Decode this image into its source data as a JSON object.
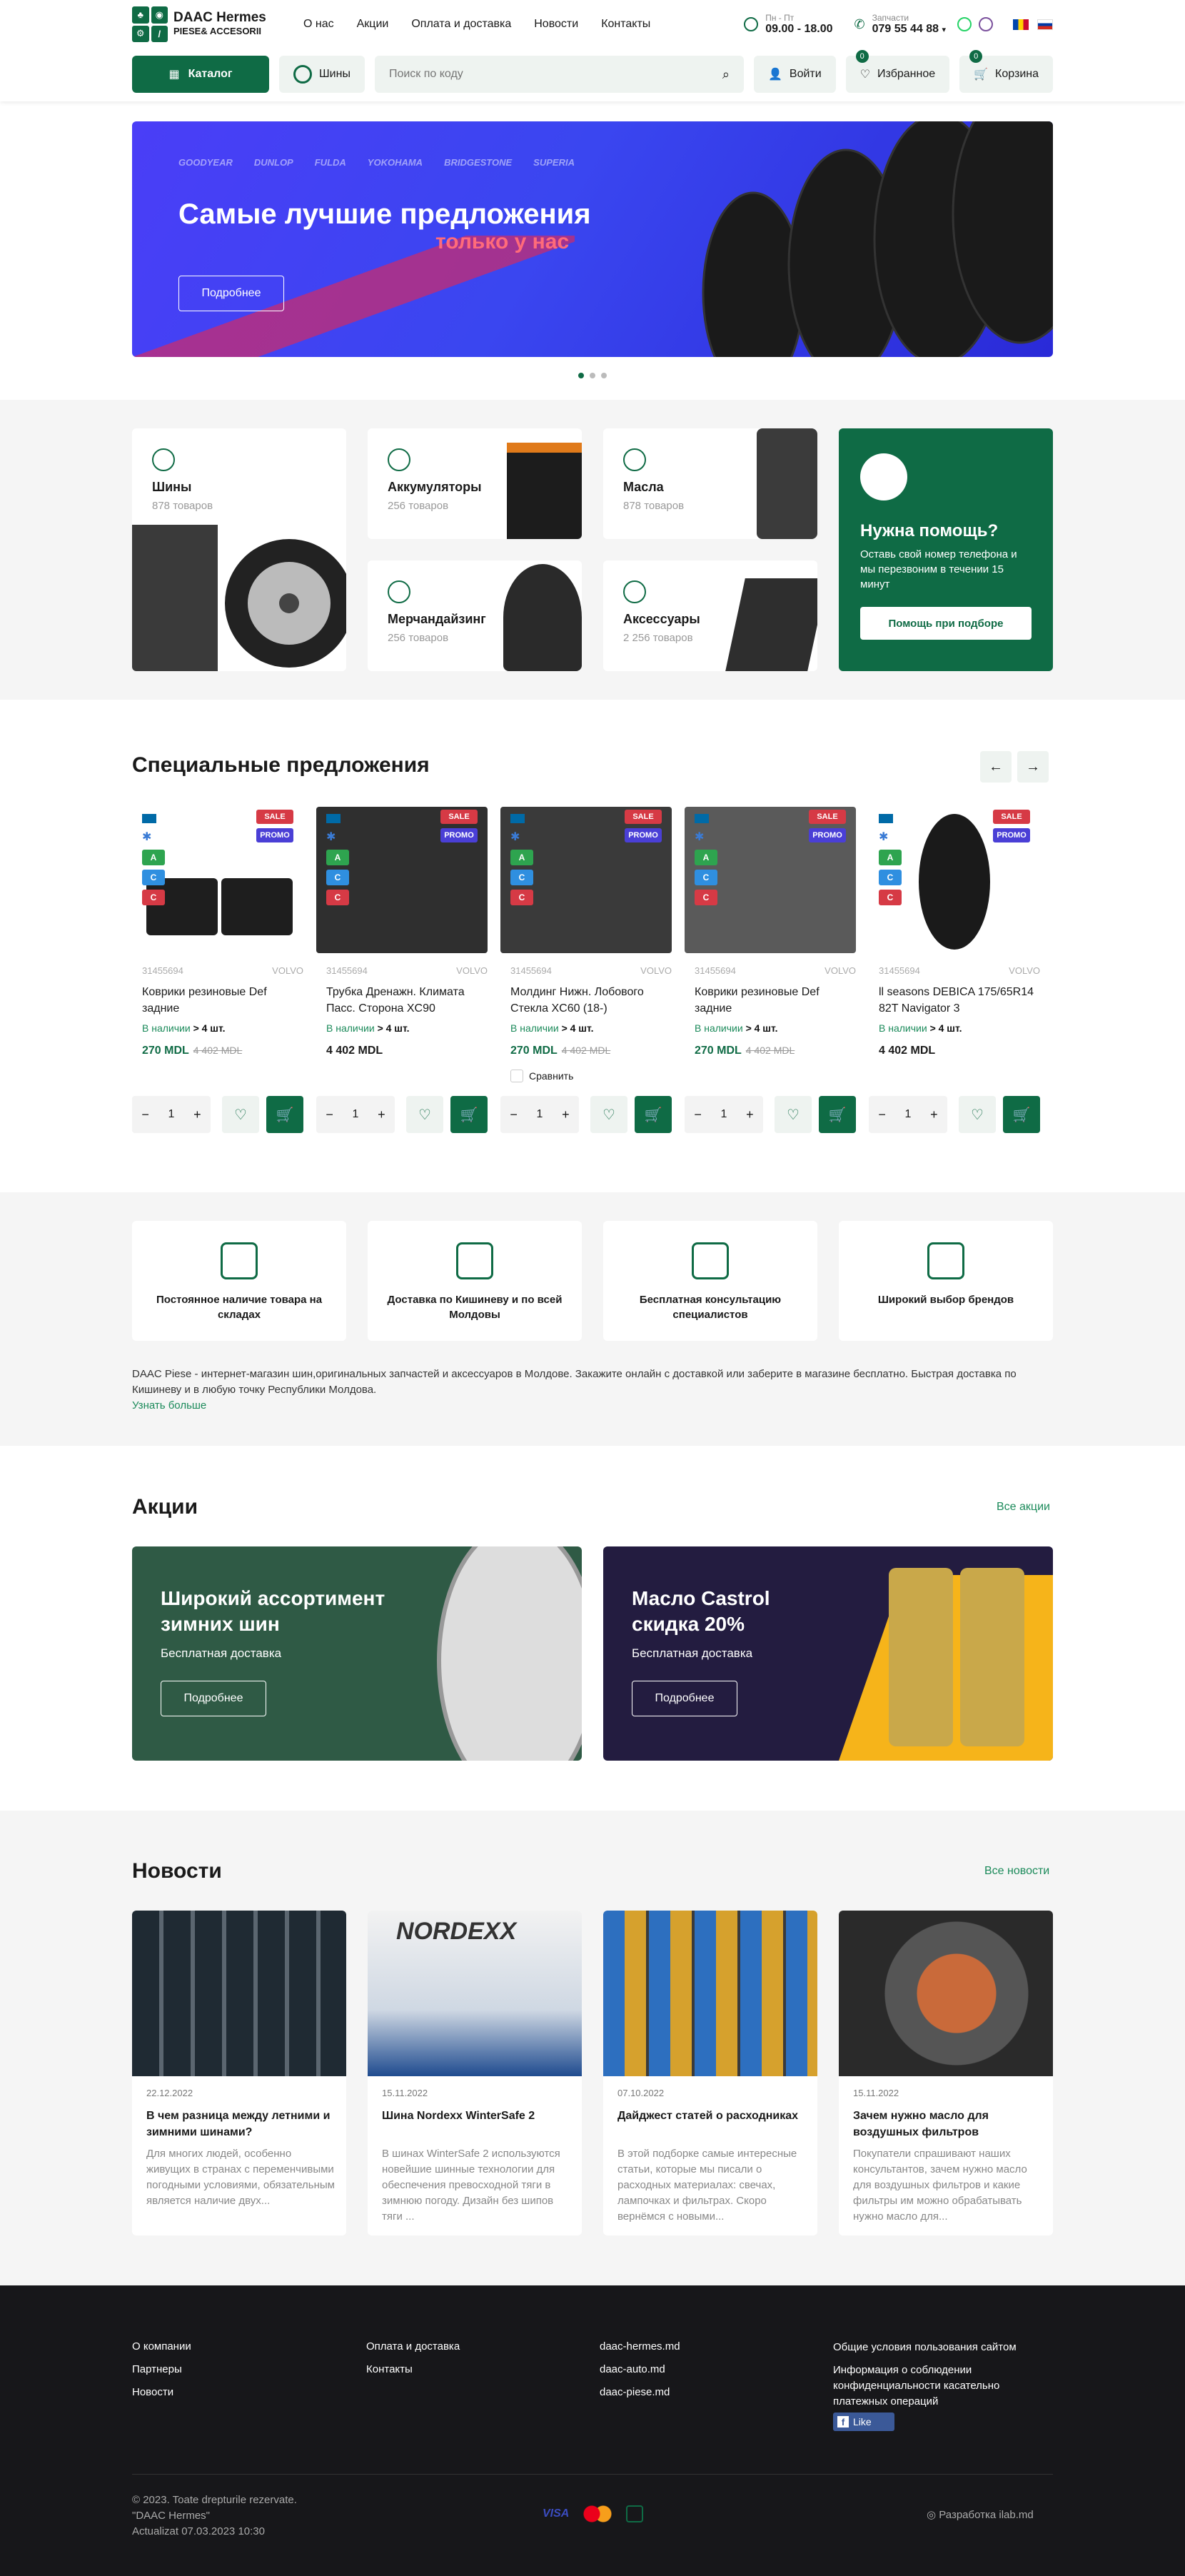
{
  "header": {
    "logo_title": "DAAC Hermes",
    "logo_subtitle": "PIESE& ACCESORII",
    "nav": [
      "О нас",
      "Акции",
      "Оплата и доставка",
      "Новости",
      "Контакты"
    ],
    "hours_label": "Пн - Пт",
    "hours_value": "09.00 - 18.00",
    "phone_label": "Запчасти",
    "phone_value": "079 55 44 88"
  },
  "toolbar": {
    "catalog_label": "Каталог",
    "tires_label": "Шины",
    "search_placeholder": "Поиск по коду",
    "login_label": "Войти",
    "favorites_label": "Избранное",
    "favorites_count": "0",
    "cart_label": "Корзина",
    "cart_count": "0"
  },
  "hero": {
    "brands": [
      "GOODYEAR",
      "DUNLOP",
      "FULDA",
      "YOKOHAMA",
      "BRIDGESTONE",
      "SUPERIA"
    ],
    "title": "Самые лучшие предложения",
    "subtitle": "только у нас",
    "button": "Подробнее"
  },
  "categories": [
    {
      "name": "Шины",
      "count": "878 товаров"
    },
    {
      "name": "Аккумуляторы",
      "count": "256 товаров"
    },
    {
      "name": "Масла",
      "count": "878 товаров"
    },
    {
      "name": "Мерчандайзинг",
      "count": "256 товаров"
    },
    {
      "name": "Аксессуары",
      "count": "2 256 товаров"
    }
  ],
  "help": {
    "title": "Нужна помощь?",
    "text": "Оставь свой номер телефона и мы перезвоним в течении 15 минут",
    "button": "Помощь при подборе"
  },
  "specials": {
    "title": "Специальные предложения",
    "sale_tag": "SALE",
    "promo_tag": "PROMO",
    "stock_label": "В наличии",
    "stock_value": "> 4 шт.",
    "compare_label": "Сравнить",
    "products": [
      {
        "sku": "31455694",
        "brand": "VOLVO",
        "name": "Коврики резиновые Def задние",
        "price": "270 MDL",
        "old_price": "4 402 MDL"
      },
      {
        "sku": "31455694",
        "brand": "VOLVO",
        "name": "Трубка Дренажн. Климата Пасс. Сторона XC90",
        "price": "4 402 MDL",
        "old_price": ""
      },
      {
        "sku": "31455694",
        "brand": "VOLVO",
        "name": "Молдинг Нижн. Лобового Стекла XC60 (18-)",
        "price": "270 MDL",
        "old_price": "4 402 MDL"
      },
      {
        "sku": "31455694",
        "brand": "VOLVO",
        "name": "Коврики резиновые Def задние",
        "price": "270 MDL",
        "old_price": "4 402 MDL"
      },
      {
        "sku": "31455694",
        "brand": "VOLVO",
        "name": "ll seasons DEBICA 175/65R14 82T Navigator 3",
        "price": "4 402 MDL",
        "old_price": ""
      }
    ],
    "qty": "1"
  },
  "features": [
    "Постоянное наличие товара на складах",
    "Доставка по Кишиневу и по всей Молдовы",
    "Бесплатная консультацию специалистов",
    "Широкий выбор брендов"
  ],
  "about": {
    "text": "DAAC Piese - интернет-магазин шин,оригинальных запчастей и аксессуаров в Молдове. Закажите онлайн с доставкой или заберите в магазине бесплатно. Быстрая доставка по Кишиневу и в любую точку Республики Молдова.",
    "link": "Узнать больше"
  },
  "promos": {
    "title": "Акции",
    "all": "Все акции",
    "items": [
      {
        "title": "Широкий ассортимент зимних шин",
        "text": "Бесплатная доставка",
        "button": "Подробнее"
      },
      {
        "title": "Масло Castrol скидка 20%",
        "text": "Бесплатная доставка",
        "button": "Подробнее"
      }
    ]
  },
  "news": {
    "title": "Новости",
    "all": "Все новости",
    "items": [
      {
        "date": "22.12.2022",
        "title": "В чем разница между летними и зимними шинами?",
        "text": "Для многих людей, особенно живущих в странах с переменчивыми погодными условиями, обязательным является наличие двух..."
      },
      {
        "date": "15.11.2022",
        "title": "Шина Nordexx WinterSafe 2",
        "text": "В шинах WinterSafe 2 используются новейшие шинные технологии для обеспечения превосходной тяги в зимнюю погоду. Дизайн без шипов тяги ..."
      },
      {
        "date": "07.10.2022",
        "title": "Дайджест статей о расходниках",
        "text": "В этой подборке самые интересные статьи, которые мы писали о расходных материалах: свечах, лампочках и фильтрах. Скоро вернёмся с новыми..."
      },
      {
        "date": "15.11.2022",
        "title": "Зачем нужно масло для воздушных фильтров",
        "text": "Покупатели спрашивают наших консультантов, зачем нужно масло для воздушных фильтров и какие фильтры им можно обрабатывать нужно масло для..."
      }
    ],
    "nordexx_logo": "NORDEXX"
  },
  "footer": {
    "col1": [
      "О компании",
      "Партнеры",
      "Новости"
    ],
    "col2": [
      "Оплата и доставка",
      "Контакты"
    ],
    "col3": [
      "daac-hermes.md",
      "daac-auto.md",
      "daac-piese.md"
    ],
    "col4_title": "Общие условия пользования сайтом",
    "col4_text": "Информация о соблюдении конфиденциальности касательно платежных операций",
    "like": "Like",
    "copy1": "© 2023. Toate drepturile rezervate.",
    "copy2": "\"DAAC Hermes\"",
    "copy3": "Actualizat 07.03.2023 10:30",
    "visa": "VISA",
    "dev": "Разработка ilab.md"
  },
  "colors": {
    "brand": "#0f6b45",
    "sale": "#d63a45",
    "promo": "#4a3fd6"
  }
}
